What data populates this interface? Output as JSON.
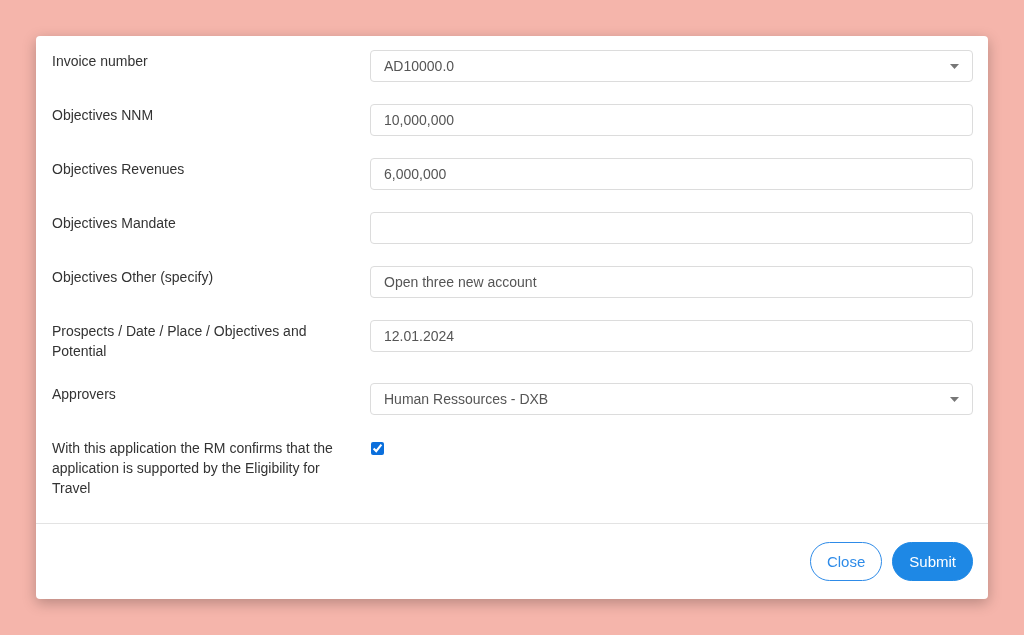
{
  "form": {
    "fields": [
      {
        "kind": "select",
        "label": "Invoice number",
        "value": "AD10000.0"
      },
      {
        "kind": "text",
        "label": "Objectives NNM",
        "value": "10,000,000"
      },
      {
        "kind": "text",
        "label": "Objectives Revenues",
        "value": "6,000,000"
      },
      {
        "kind": "text",
        "label": "Objectives Mandate"
      },
      {
        "kind": "text",
        "label": "Objectives Other (specify)",
        "value": "Open three new account"
      },
      {
        "kind": "text",
        "label": "Prospects / Date / Place / Objectives and Potential",
        "value": "12.01.2024"
      },
      {
        "kind": "select",
        "label": "Approvers",
        "value": "Human Ressources - DXB"
      },
      {
        "kind": "checkbox",
        "label": "With this application the RM confirms that the application is supported by the Eligibility for Travel",
        "checked": true
      }
    ]
  },
  "buttons": [
    {
      "kind": "outline",
      "label": "Close"
    },
    {
      "kind": "primary",
      "label": "Submit"
    }
  ]
}
